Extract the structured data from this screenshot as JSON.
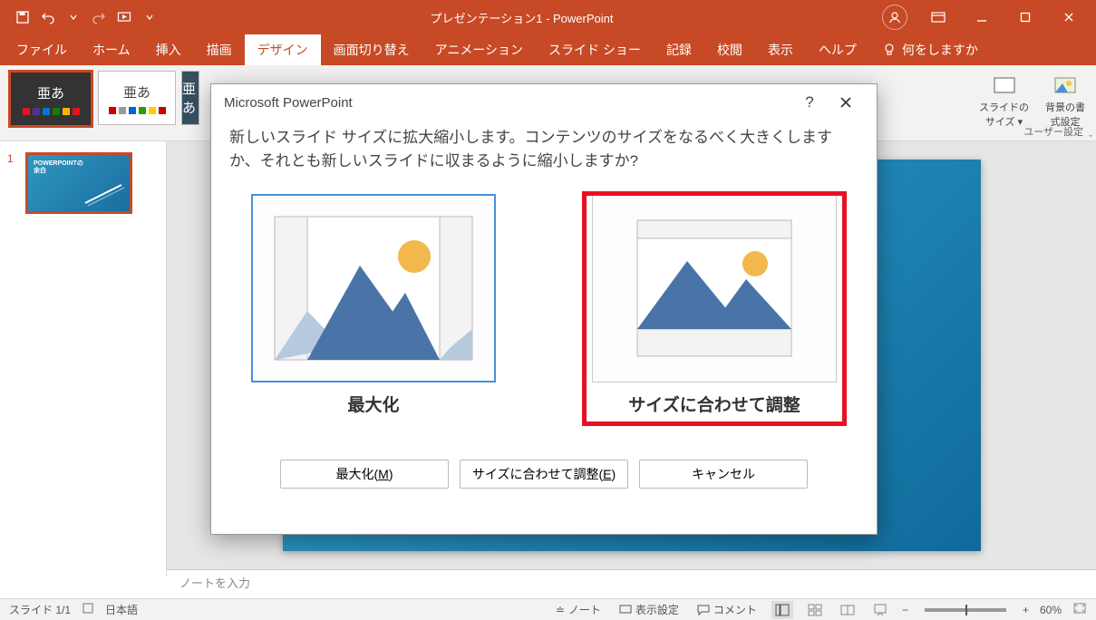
{
  "titlebar": {
    "title": "プレゼンテーション1 - PowerPoint"
  },
  "ribbon_tabs": {
    "file": "ファイル",
    "home": "ホーム",
    "insert": "挿入",
    "draw": "描画",
    "design": "デザイン",
    "transitions": "画面切り替え",
    "animations": "アニメーション",
    "slideshow": "スライド ショー",
    "record": "記録",
    "review": "校閲",
    "view": "表示",
    "help": "ヘルプ",
    "tell_me": "何をしますか"
  },
  "ribbon": {
    "theme_text": "亜あ",
    "slide_size": "スライドの\nサイズ ▾",
    "format_bg": "背景の書\n式設定",
    "group": "ユーザー設定"
  },
  "slides": {
    "panel": [
      {
        "num": "1",
        "title": "POWERPOINTの\n余白"
      }
    ]
  },
  "notes": {
    "placeholder": "ノートを入力"
  },
  "statusbar": {
    "slide_info": "スライド 1/1",
    "lang": "日本語",
    "notes": "ノート",
    "display_settings": "表示設定",
    "comments": "コメント",
    "zoom_pct": "60%"
  },
  "dialog": {
    "title": "Microsoft PowerPoint",
    "message": "新しいスライド サイズに拡大縮小します。コンテンツのサイズをなるべく大きくしますか、それとも新しいスライドに収まるように縮小しますか?",
    "options": {
      "maximize": "最大化",
      "ensure_fit": "サイズに合わせて調整"
    },
    "buttons": {
      "maximize_pre": "最大化(",
      "maximize_key": "M",
      "maximize_post": ")",
      "fit_pre": "サイズに合わせて調整(",
      "fit_key": "E",
      "fit_post": ")",
      "cancel": "キャンセル"
    }
  }
}
